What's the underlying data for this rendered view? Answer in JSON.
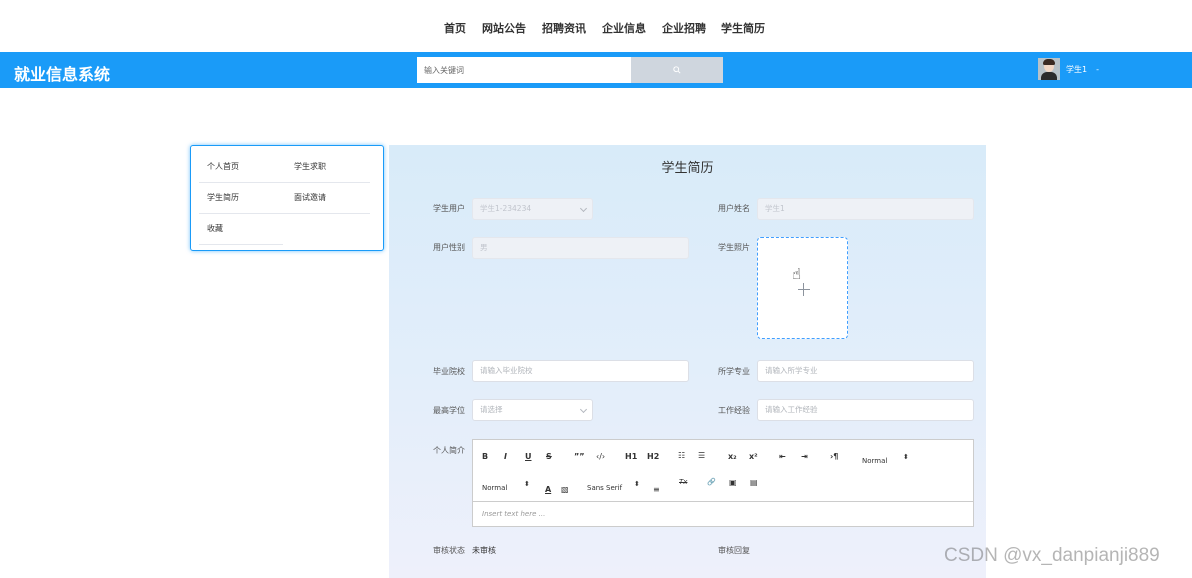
{
  "topnav": {
    "items": [
      "首页",
      "网站公告",
      "招聘资讯",
      "企业信息",
      "企业招聘",
      "学生简历"
    ]
  },
  "header": {
    "site_title": "就业信息系统",
    "search_placeholder": "输入关键词",
    "search_icon": "search-icon",
    "username": "学生1",
    "user_caret": "-"
  },
  "sidemenu": {
    "items": [
      "个人首页",
      "学生求职",
      "学生简历",
      "面试邀请",
      "收藏"
    ]
  },
  "form": {
    "title": "学生简历",
    "student_user_label": "学生用户",
    "student_user_value": "学生1-234234",
    "user_name_label": "用户姓名",
    "user_name_value": "学生1",
    "gender_label": "用户性别",
    "gender_value": "男",
    "photo_label": "学生照片",
    "school_label": "毕业院校",
    "school_placeholder": "请输入毕业院校",
    "major_label": "所学专业",
    "major_placeholder": "请输入所学专业",
    "degree_label": "最高学位",
    "degree_placeholder": "请选择",
    "experience_label": "工作经验",
    "experience_placeholder": "请输入工作经验",
    "intro_label": "个人简介",
    "editor_placeholder": "Insert text here ...",
    "review_status_label": "审核状态",
    "review_status_value": "未审核",
    "review_reply_label": "审核回复"
  },
  "editor_toolbar": {
    "bold": "B",
    "italic": "I",
    "underline": "U",
    "strike": "S",
    "blockquote": "””",
    "code": "‹/›",
    "h1": "H1",
    "h2": "H2",
    "ordered_list": "☷",
    "bullet_list": "☰",
    "sub": "x₂",
    "sup": "x²",
    "outdent": "⇤",
    "indent": "⇥",
    "direction": "›¶",
    "size_right": "Normal",
    "size_arrow": "⬍",
    "header_select": "Normal",
    "font": "Sans Serif",
    "color": "A",
    "background": "▧",
    "align": "≡",
    "clean": "Tx",
    "link": "🔗",
    "image": "▣",
    "video": "▤"
  },
  "watermark": "CSDN @vx_danpianji889",
  "colors": {
    "primary": "#1a9bf8",
    "upload_border": "#409eff"
  }
}
